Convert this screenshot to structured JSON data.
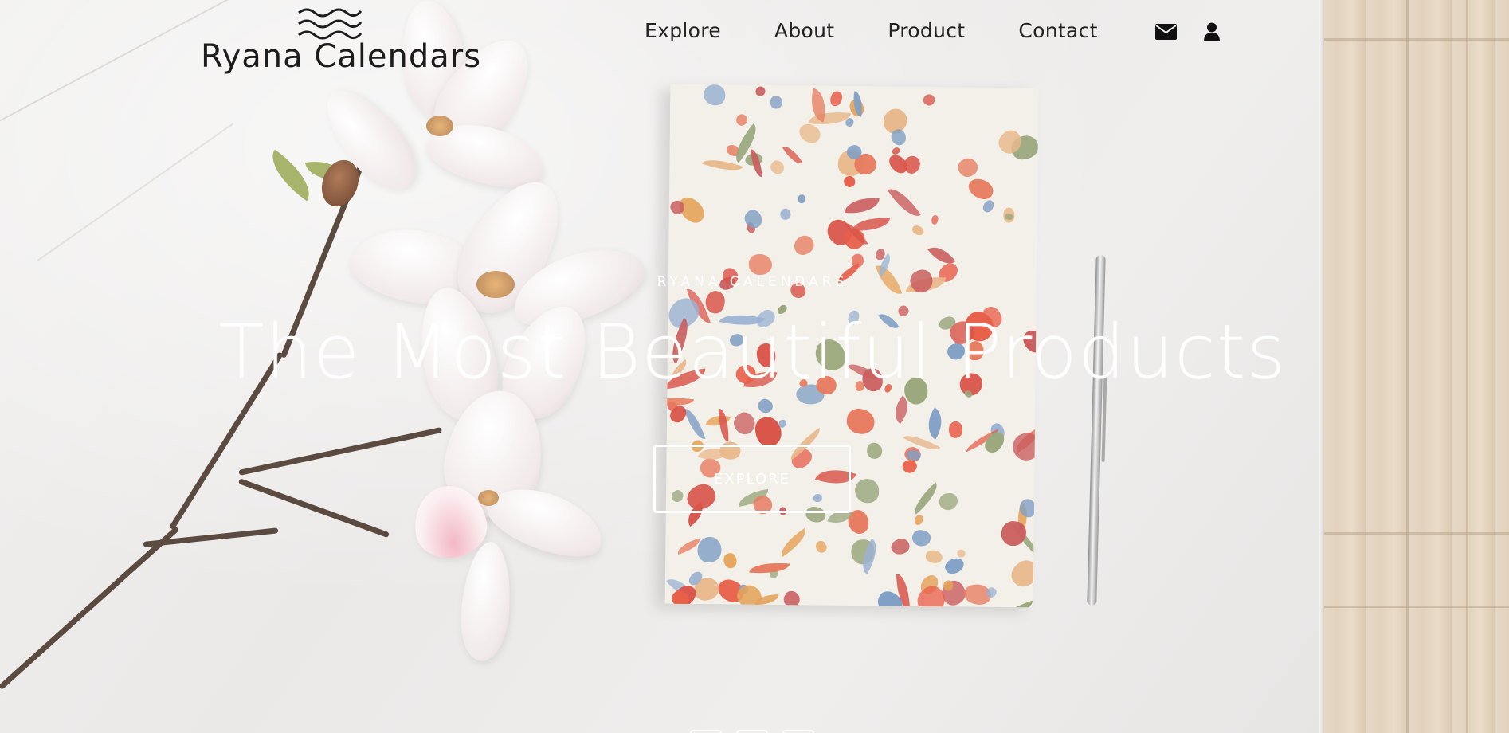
{
  "brand": {
    "name": "Ryana Calendars",
    "logo_icon": "waves-icon"
  },
  "nav": {
    "items": [
      {
        "label": "Explore"
      },
      {
        "label": "About"
      },
      {
        "label": "Product"
      },
      {
        "label": "Contact"
      }
    ],
    "icons": [
      "envelope-icon",
      "user-icon"
    ]
  },
  "hero": {
    "eyebrow": "RYANA CALENDARS",
    "headline": "The Most Beautiful Products",
    "cta_label": "EXPLORE",
    "slides": 3
  },
  "colors": {
    "text_dark": "#222222",
    "hero_text": "#ffffff",
    "accent_flower": "#e8604a"
  }
}
